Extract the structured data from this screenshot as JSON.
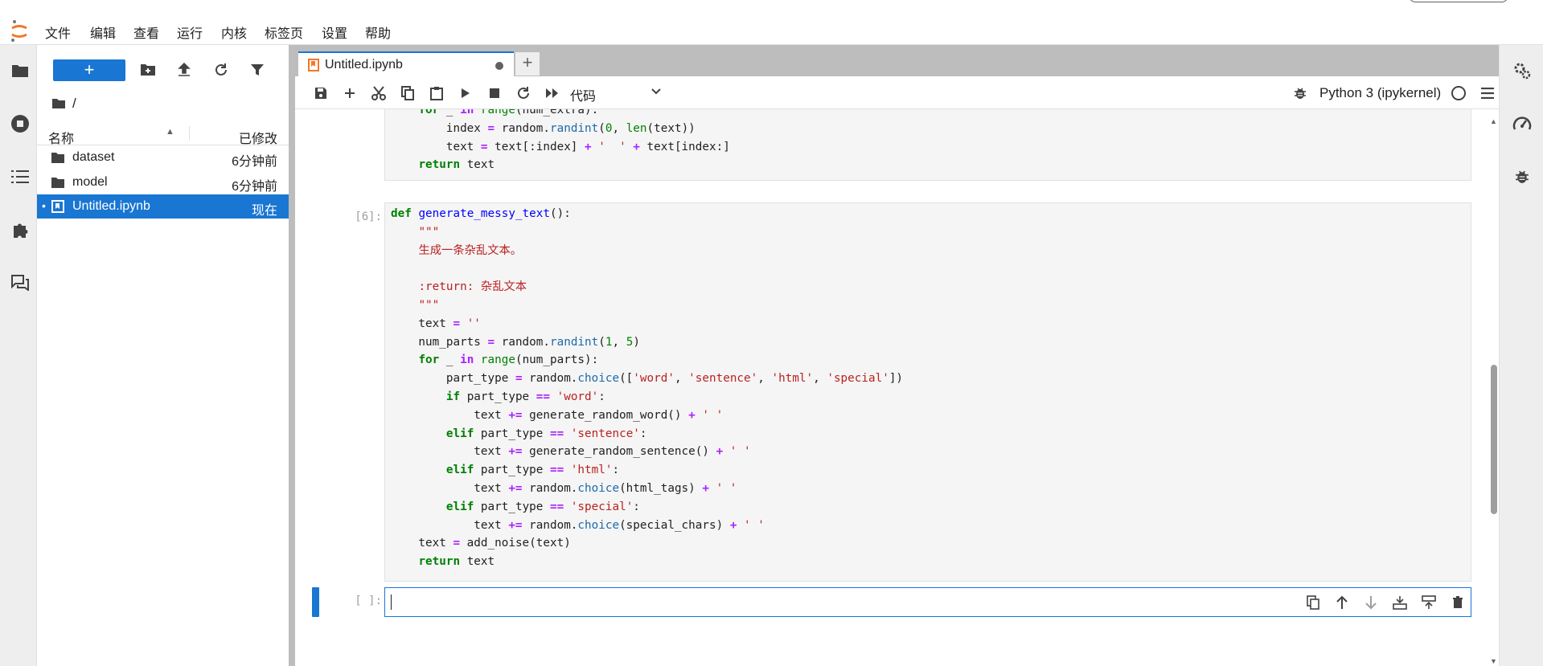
{
  "menu": [
    "文件",
    "编辑",
    "查看",
    "运行",
    "内核",
    "标签页",
    "设置",
    "帮助"
  ],
  "file_browser": {
    "new_label": "+",
    "breadcrumb": "/",
    "columns": {
      "name": "名称",
      "modified": "已修改"
    },
    "items": [
      {
        "name": "dataset",
        "modified": "6分钟前",
        "type": "folder",
        "selected": false
      },
      {
        "name": "model",
        "modified": "6分钟前",
        "type": "folder",
        "selected": false
      },
      {
        "name": "Untitled.ipynb",
        "modified": "现在",
        "type": "notebook",
        "selected": true,
        "running_dot": "•"
      }
    ]
  },
  "tab": {
    "label": "Untitled.ipynb",
    "add": "+"
  },
  "toolbar": {
    "cell_type": "代码",
    "kernel": "Python 3 (ipykernel)"
  },
  "cells": [
    {
      "prompt": "",
      "lines": [
        [
          [
            "    ",
            ""
          ],
          [
            "for",
            "kw"
          ],
          [
            " _ ",
            ""
          ],
          [
            "in",
            "op"
          ],
          [
            " ",
            ""
          ],
          [
            "range",
            "bi"
          ],
          [
            "(num_extra):",
            ""
          ]
        ],
        [
          [
            "        index ",
            ""
          ],
          [
            "=",
            "op"
          ],
          [
            " random.",
            ""
          ],
          [
            "randint",
            "at"
          ],
          [
            "(",
            ""
          ],
          [
            "0",
            "nu"
          ],
          [
            ", ",
            ""
          ],
          [
            "len",
            "bi"
          ],
          [
            "(text))",
            ""
          ]
        ],
        [
          [
            "        text ",
            ""
          ],
          [
            "=",
            "op"
          ],
          [
            " text[:index] ",
            ""
          ],
          [
            "+",
            "op"
          ],
          [
            " ",
            ""
          ],
          [
            "'  '",
            "st"
          ],
          [
            " ",
            ""
          ],
          [
            "+",
            "op"
          ],
          [
            " text[index:]",
            ""
          ]
        ],
        [
          [
            "    ",
            ""
          ],
          [
            "return",
            "kw"
          ],
          [
            " text",
            ""
          ]
        ]
      ]
    },
    {
      "prompt": "[6]:",
      "lines": [
        [
          [
            "def",
            "kw"
          ],
          [
            " ",
            ""
          ],
          [
            "generate_messy_text",
            "fn"
          ],
          [
            "():",
            ""
          ]
        ],
        [
          [
            "    ",
            ""
          ],
          [
            "\"\"\"",
            "st"
          ]
        ],
        [
          [
            "    ",
            ""
          ],
          [
            "生成一条杂乱文本。",
            "st"
          ]
        ],
        [
          [
            "",
            ""
          ]
        ],
        [
          [
            "    ",
            ""
          ],
          [
            ":return: 杂乱文本",
            "st"
          ]
        ],
        [
          [
            "    ",
            ""
          ],
          [
            "\"\"\"",
            "st"
          ]
        ],
        [
          [
            "    text ",
            ""
          ],
          [
            "=",
            "op"
          ],
          [
            " ",
            ""
          ],
          [
            "''",
            "st"
          ]
        ],
        [
          [
            "    num_parts ",
            ""
          ],
          [
            "=",
            "op"
          ],
          [
            " random.",
            ""
          ],
          [
            "randint",
            "at"
          ],
          [
            "(",
            ""
          ],
          [
            "1",
            "nu"
          ],
          [
            ", ",
            ""
          ],
          [
            "5",
            "nu"
          ],
          [
            ")",
            ""
          ]
        ],
        [
          [
            "    ",
            ""
          ],
          [
            "for",
            "kw"
          ],
          [
            " _ ",
            ""
          ],
          [
            "in",
            "op"
          ],
          [
            " ",
            ""
          ],
          [
            "range",
            "bi"
          ],
          [
            "(num_parts):",
            ""
          ]
        ],
        [
          [
            "        part_type ",
            ""
          ],
          [
            "=",
            "op"
          ],
          [
            " random.",
            ""
          ],
          [
            "choice",
            "at"
          ],
          [
            "([",
            ""
          ],
          [
            "'word'",
            "st"
          ],
          [
            ", ",
            ""
          ],
          [
            "'sentence'",
            "st"
          ],
          [
            ", ",
            ""
          ],
          [
            "'html'",
            "st"
          ],
          [
            ", ",
            ""
          ],
          [
            "'special'",
            "st"
          ],
          [
            "])",
            ""
          ]
        ],
        [
          [
            "        ",
            ""
          ],
          [
            "if",
            "kw"
          ],
          [
            " part_type ",
            ""
          ],
          [
            "==",
            "op"
          ],
          [
            " ",
            ""
          ],
          [
            "'word'",
            "st"
          ],
          [
            ":",
            ""
          ]
        ],
        [
          [
            "            text ",
            ""
          ],
          [
            "+=",
            "op"
          ],
          [
            " generate_random_word() ",
            ""
          ],
          [
            "+",
            "op"
          ],
          [
            " ",
            ""
          ],
          [
            "' '",
            "st"
          ]
        ],
        [
          [
            "        ",
            ""
          ],
          [
            "elif",
            "kw"
          ],
          [
            " part_type ",
            ""
          ],
          [
            "==",
            "op"
          ],
          [
            " ",
            ""
          ],
          [
            "'sentence'",
            "st"
          ],
          [
            ":",
            ""
          ]
        ],
        [
          [
            "            text ",
            ""
          ],
          [
            "+=",
            "op"
          ],
          [
            " generate_random_sentence() ",
            ""
          ],
          [
            "+",
            "op"
          ],
          [
            " ",
            ""
          ],
          [
            "' '",
            "st"
          ]
        ],
        [
          [
            "        ",
            ""
          ],
          [
            "elif",
            "kw"
          ],
          [
            " part_type ",
            ""
          ],
          [
            "==",
            "op"
          ],
          [
            " ",
            ""
          ],
          [
            "'html'",
            "st"
          ],
          [
            ":",
            ""
          ]
        ],
        [
          [
            "            text ",
            ""
          ],
          [
            "+=",
            "op"
          ],
          [
            " random.",
            ""
          ],
          [
            "choice",
            "at"
          ],
          [
            "(html_tags) ",
            ""
          ],
          [
            "+",
            "op"
          ],
          [
            " ",
            ""
          ],
          [
            "' '",
            "st"
          ]
        ],
        [
          [
            "        ",
            ""
          ],
          [
            "elif",
            "kw"
          ],
          [
            " part_type ",
            ""
          ],
          [
            "==",
            "op"
          ],
          [
            " ",
            ""
          ],
          [
            "'special'",
            "st"
          ],
          [
            ":",
            ""
          ]
        ],
        [
          [
            "            text ",
            ""
          ],
          [
            "+=",
            "op"
          ],
          [
            " random.",
            ""
          ],
          [
            "choice",
            "at"
          ],
          [
            "(special_chars) ",
            ""
          ],
          [
            "+",
            "op"
          ],
          [
            " ",
            ""
          ],
          [
            "' '",
            "st"
          ]
        ],
        [
          [
            "    text ",
            ""
          ],
          [
            "=",
            "op"
          ],
          [
            " add_noise(text)",
            ""
          ]
        ],
        [
          [
            "    ",
            ""
          ],
          [
            "return",
            "kw"
          ],
          [
            " text",
            ""
          ]
        ]
      ]
    }
  ],
  "active_cell": {
    "prompt": "[ ]:"
  },
  "colors": {
    "accent": "#1976d2",
    "rail": "#eeeeee",
    "tabbar": "#bdbdbd",
    "cell_bg": "#f5f5f5"
  }
}
